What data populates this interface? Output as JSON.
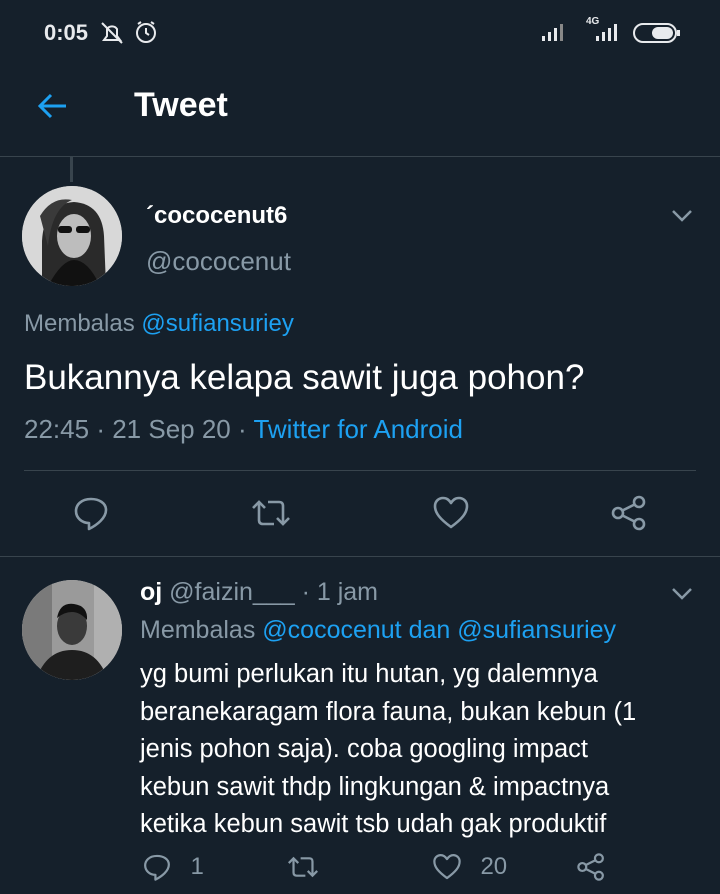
{
  "status_bar": {
    "time": "0:05",
    "network_label": "4G",
    "icons": [
      "mute-notification-icon",
      "alarm-icon",
      "signal-icon",
      "signal-4g-icon",
      "battery-icon"
    ]
  },
  "header": {
    "title": "Tweet",
    "back_icon": "back-arrow-icon"
  },
  "main_tweet": {
    "display_name": "´cococenut6",
    "handle": "@cococenut",
    "replying_label": "Membalas",
    "replying_to": "@sufiansuriey",
    "text": "Bukannya kelapa sawit juga pohon?",
    "time": "22:45",
    "date": "21 Sep 20",
    "separator": "·",
    "source": "Twitter for Android",
    "actions": [
      "reply-icon",
      "retweet-icon",
      "like-icon",
      "share-icon"
    ]
  },
  "reply": {
    "display_name": "oj",
    "handle": "@faizin___",
    "separator": "·",
    "time_ago": "1 jam",
    "replying_label": "Membalas",
    "replying_to_1": "@cococenut",
    "conjunction": "dan",
    "replying_to_2": "@sufiansuriey",
    "lines": [
      "yg bumi perlukan itu hutan, yg dalemnya",
      "beranekaragam flora fauna, bukan kebun (1",
      "jenis pohon saja). coba googling impact",
      "kebun sawit thdp lingkungan & impactnya",
      "ketika kebun sawit tsb udah gak produktif"
    ],
    "reply_count": "1",
    "like_count": "20"
  },
  "colors": {
    "background": "#15202b",
    "accent": "#1da1f2",
    "secondary_text": "#8899a6",
    "divider": "#38444d"
  }
}
